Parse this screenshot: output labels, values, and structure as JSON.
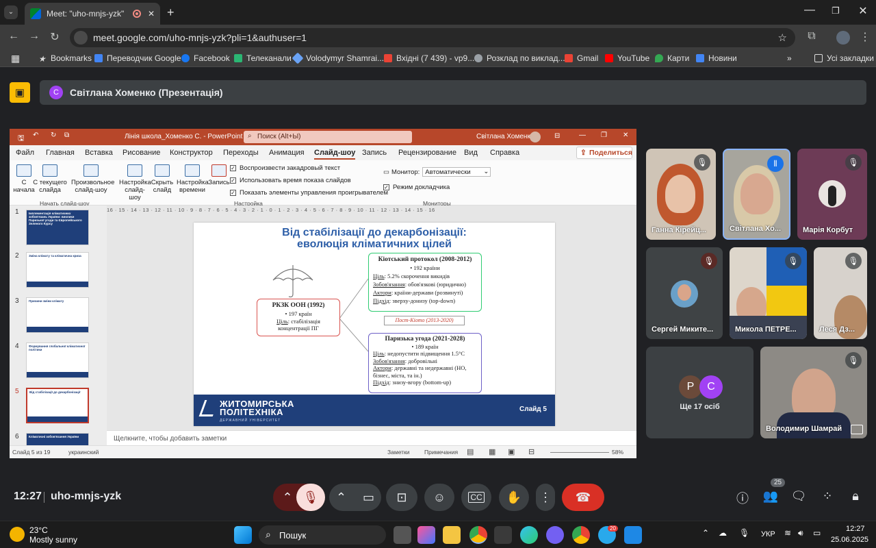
{
  "browser": {
    "tab_title": "Meet: \"uho-mnjs-yzk\"",
    "url": "meet.google.com/uho-mnjs-yzk?pli=1&authuser=1",
    "bookmarks": [
      "Bookmarks",
      "Переводчик Google",
      "Facebook",
      "Телеканали",
      "Volodymyr Shamrai...",
      "Вхідні (7 439) - vp9...",
      "Розклад по виклад...",
      "Gmail",
      "YouTube",
      "Карти",
      "Новини"
    ],
    "all_bookmarks": "Усі закладки"
  },
  "meet": {
    "presenter_initial": "С",
    "presenter_label": "Світлана Хоменко (Презентація)",
    "time": "12:27",
    "meeting_code": "uho-mnjs-yzk",
    "participants_badge": "25",
    "participants": [
      {
        "name": "Ганна Кірейц..."
      },
      {
        "name": "Світлана Хо..."
      },
      {
        "name": "Марія Корбут"
      },
      {
        "name": "Сергей Миките..."
      },
      {
        "name": "Микола ПЕТРЕ..."
      },
      {
        "name": "Леся Дз..."
      },
      {
        "name": "Ще 17 осіб",
        "initials": [
          "Р",
          "С"
        ]
      },
      {
        "name": "Володимир Шамрай"
      }
    ]
  },
  "ppt": {
    "file_title": "Лінія школа_Хоменко С. - PowerPoint",
    "search": "Поиск (Alt+Ы)",
    "user": "Світлана Хоменко",
    "ribbon_tabs": [
      "Файл",
      "Главная",
      "Вставка",
      "Рисование",
      "Конструктор",
      "Переходы",
      "Анимация",
      "Слайд-шоу",
      "Запись",
      "Рецензирование",
      "Вид",
      "Справка"
    ],
    "share": "Поделиться",
    "buttons": [
      "С начала",
      "С текущего слайда",
      "Произвольное слайд-шоу",
      "Настройка слайд-шоу",
      "Скрыть слайд",
      "Настройка времени",
      "Запись"
    ],
    "checks": [
      "Воспроизвести закадровый текст",
      "Использовать время показа слайдов",
      "Показать элементы управления проигрывателем",
      "Режим докладчика"
    ],
    "monitor_label": "Монитор:",
    "monitor_value": "Автоматически",
    "groups": [
      "Начать слайд-шоу",
      "Настройка",
      "Мониторы"
    ],
    "ruler": "16 · 15 · 14 · 13 · 12 · 11 · 10 · 9 · 8 · 7 · 6 · 5 · 4 · 3 · 2 · 1 · 0 · 1 · 2 · 3 · 4 · 5 · 6 · 7 · 8 · 9 · 10 · 11 · 12 · 13 · 14 · 15 · 16",
    "thumb_numbers": [
      "1",
      "2",
      "3",
      "4",
      "5",
      "6"
    ],
    "thumb_titles": [
      "Імплементація кліматичних зобов'язань України: виклики Паризької угоди та Європейського Зеленого Курсу",
      "Зміна клімату та кліматична криза",
      "Причини зміни клімату",
      "Формування глобальної кліматичної політики",
      "Від стабілізації до декарбонізації",
      "Кліматичні зобов'язання України"
    ],
    "notes": "Щелкните, чтобы добавить заметки",
    "status_slide": "Слайд 5 из 19",
    "status_lang": "украинский",
    "status_notes": "Заметки",
    "status_comments": "Примечания",
    "zoom": "58%"
  },
  "slide": {
    "title_line1": "Від стабілізації до декарбонізації:",
    "title_line2": "еволюція кліматичних цілей",
    "unfccc": {
      "title": "РКЗК ООН (1992)",
      "count": "197 країн",
      "goal_label": "Ціль",
      "goal": ": стабілізація концентрації ПГ"
    },
    "kyoto": {
      "title": "Кіотський протокол (2008-2012)",
      "count": "192 країни",
      "goal_label": "Ціль",
      "goal": ": 5.2% скорочення викидів",
      "oblig_label": "Зобов'язання",
      "oblig": ": обов'язкові (юридично)",
      "actors_label": "Актори",
      "actors": ": країни-держави (розвинуті)",
      "approach_label": "Підхід",
      "approach": ": зверху-донизу (top-down)"
    },
    "post_kyoto": "Пост-Кіото (2013-2020)",
    "paris": {
      "title": "Паризька угода (2021-2028)",
      "count": "189 країн",
      "goal_label": "Ціль",
      "goal": ": недопустити підвищення 1.5°С",
      "oblig_label": "Зобов'язання",
      "oblig": ": добровільні",
      "actors_label": "Актори",
      "actors": ": державні та недержавні (НО, бізнес, міста, та ін.)",
      "approach_label": "Підхід",
      "approach": ": знизу-вгору (bottom-up)"
    },
    "logo_line1": "ЖИТОМИРСЬКА",
    "logo_line2": "ПОЛІТЕХНІКА",
    "logo_sub": "ДЕРЖАВНИЙ УНІВЕРСИТЕТ",
    "slide_number": "Слайд 5"
  },
  "taskbar": {
    "temp": "23°C",
    "weather": "Mostly sunny",
    "search": "Пошук",
    "lang": "УКР",
    "time": "12:27",
    "date": "25.06.2025",
    "telegram_badge": "20"
  }
}
